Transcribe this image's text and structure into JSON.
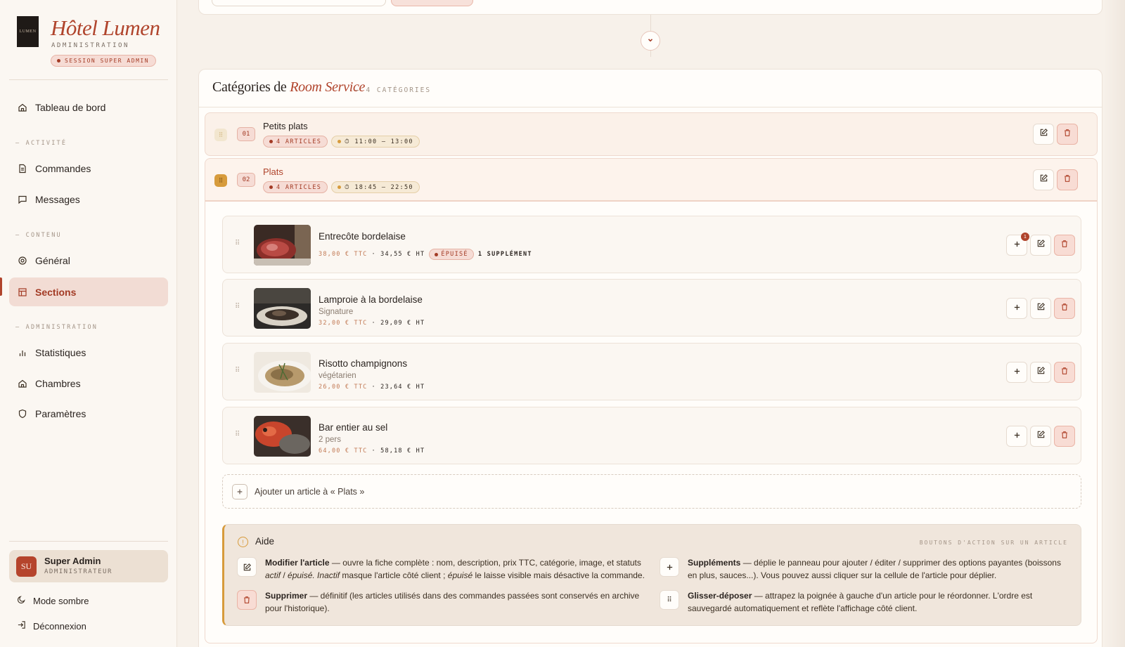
{
  "brand": {
    "logo_text": "LUMEN",
    "name": "Hôtel Lumen",
    "subtitle": "ADMINISTRATION",
    "session_badge": "SESSION SUPER ADMIN"
  },
  "nav": {
    "dashboard": "Tableau de bord",
    "section_activity": "— ACTIVITÉ",
    "orders": "Commandes",
    "messages": "Messages",
    "section_content": "— CONTENU",
    "general": "Général",
    "sections": "Sections",
    "section_admin": "— ADMINISTRATION",
    "stats": "Statistiques",
    "rooms": "Chambres",
    "settings": "Paramètres"
  },
  "user": {
    "initials": "SU",
    "name": "Super Admin",
    "role": "ADMINISTRATEUR",
    "dark_mode": "Mode sombre",
    "logout": "Déconnexion"
  },
  "panel": {
    "title_prefix": "Catégories de ",
    "title_emph": "Room Service",
    "count": "— 4 CATÉGORIES"
  },
  "categories": [
    {
      "num": "01",
      "name": "Petits plats",
      "articles": "4 ARTICLES",
      "hours": "⏱ 11:00 – 13:00"
    },
    {
      "num": "02",
      "name": "Plats",
      "articles": "4 ARTICLES",
      "hours": "⏱ 18:45 – 22:50"
    }
  ],
  "items": [
    {
      "name": "Entrecôte bordelaise",
      "sub": "",
      "ttc": "38,00 € TTC",
      "ht": "· 34,55 € HT",
      "sold_out": "ÉPUISÉ",
      "supplements": "1 SUPPLÉMENT",
      "badge": "1"
    },
    {
      "name": "Lamproie à la bordelaise",
      "sub": "Signature",
      "ttc": "32,00 € TTC",
      "ht": "· 29,09 € HT"
    },
    {
      "name": "Risotto champignons",
      "sub": "végétarien",
      "ttc": "26,00 € TTC",
      "ht": "· 23,64 € HT"
    },
    {
      "name": "Bar entier au sel",
      "sub": "2 pers",
      "ttc": "64,00 € TTC",
      "ht": "· 58,18 € HT"
    }
  ],
  "add_item": "Ajouter un article à « Plats »",
  "help": {
    "title": "Aide",
    "right_label": "BOUTONS D'ACTION SUR UN ARTICLE",
    "edit_bold": "Modifier l'article",
    "edit_text": " — ouvre la fiche complète : nom, description, prix TTC, catégorie, image, et statuts ",
    "edit_actif": "actif",
    "edit_sep": " / ",
    "edit_epuise": "épuisé. Inactif",
    "edit_text2": " masque l'article côté client ; ",
    "edit_epuise2": "épuisé",
    "edit_text3": " le laisse visible mais désactive la commande.",
    "delete_bold": "Supprimer",
    "delete_text": " — définitif (les articles utilisés dans des commandes passées sont conservés en archive pour l'historique).",
    "supp_bold": "Suppléments",
    "supp_text": " — déplie le panneau pour ajouter / éditer / supprimer des options payantes (boissons en plus, sauces...). Vous pouvez aussi cliquer sur la cellule de l'article pour déplier.",
    "drag_bold": "Glisser-déposer",
    "drag_text": " — attrapez la poignée à gauche d'un article pour le réordonner. L'ordre est sauvegardé automatiquement et reflète l'affichage côté client."
  },
  "colors": {
    "accent": "#b0442c",
    "accent_soft": "#f6dcd5",
    "amber": "#d79b3c",
    "background": "#f7f1ea"
  }
}
